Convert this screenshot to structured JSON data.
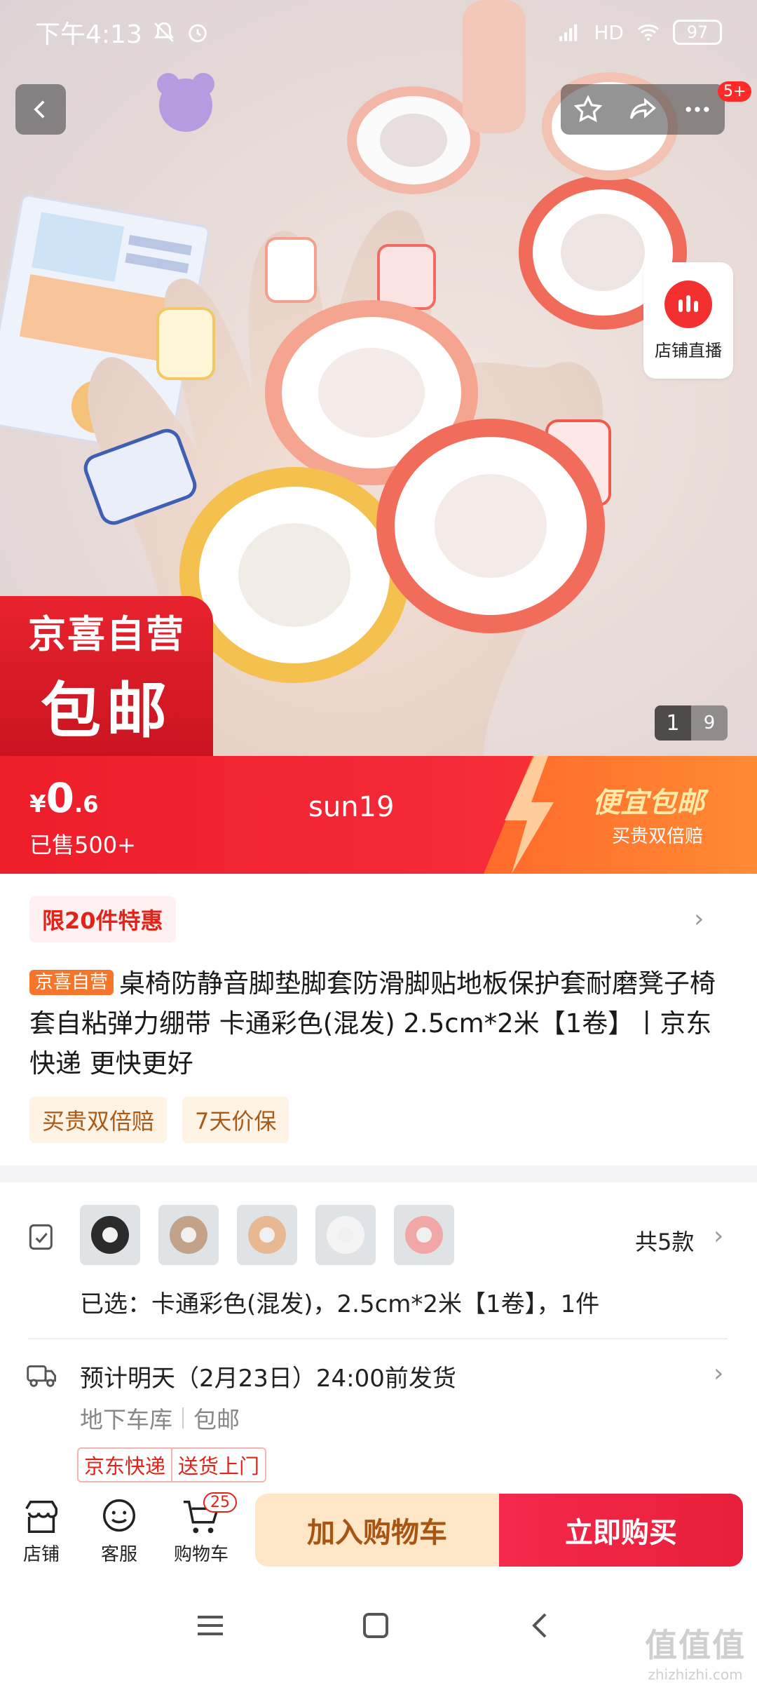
{
  "status_bar": {
    "time": "下午4:13",
    "network": "HD",
    "battery": "97"
  },
  "top_actions": {
    "notification_badge": "5+"
  },
  "live": {
    "label": "店铺直播"
  },
  "promo_badge": {
    "line1": "京喜自营",
    "line2": "包邮"
  },
  "image_counter": {
    "current": "1",
    "total": "9"
  },
  "price": {
    "currency": "¥",
    "integer": "0",
    "decimal": ".6",
    "sold": "已售500+",
    "center_text": "sun19",
    "promo_title": "便宜包邮",
    "promo_sub": "买贵双倍赔"
  },
  "product": {
    "limit_tag": "限20件特惠",
    "self_tag": "京喜自营",
    "title": "桌椅防静音脚垫脚套防滑脚贴地板保护套耐磨凳子椅套自粘弹力绷带 卡通彩色(混发) 2.5cm*2米【1卷】丨京东快递 更快更好",
    "service_tags": [
      "买贵双倍赔",
      "7天价保"
    ]
  },
  "variants": {
    "count": "共5款",
    "selected": "已选：卡通彩色(混发)，2.5cm*2米【1卷】，1件",
    "thumb_colors": [
      "#2b2b2b",
      "#c2a38a",
      "#e8b893",
      "#f4f4f4",
      "#f2a7a7"
    ]
  },
  "shipping": {
    "line1": "预计明天（2月23日）24:00前发货",
    "origin": "地下车库",
    "fee": "包邮",
    "express": "京东快递",
    "delivery": "送货上门"
  },
  "actionbar": {
    "store": "店铺",
    "service": "客服",
    "cart": "购物车",
    "cart_count": "25",
    "add_to_cart": "加入购物车",
    "buy_now": "立即购买"
  },
  "watermark": {
    "line1": "值值值",
    "line2": "zhizhizhi.com"
  }
}
